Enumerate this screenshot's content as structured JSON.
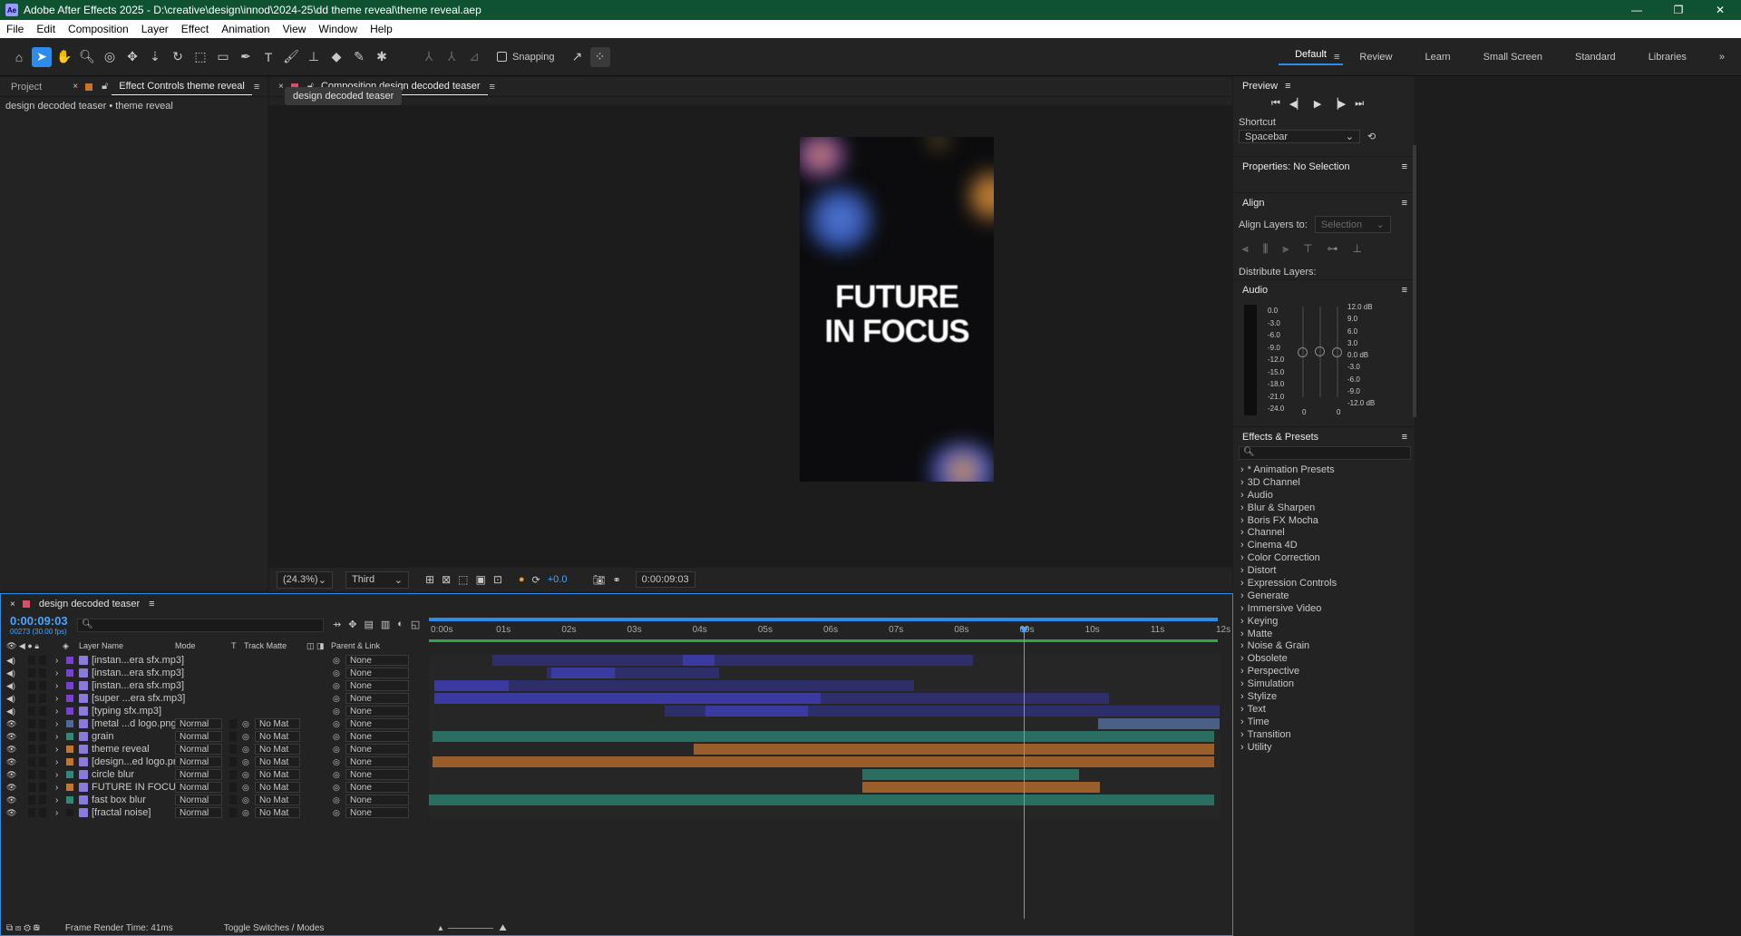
{
  "app": {
    "title": "Adobe After Effects 2025 - D:\\creative\\design\\innod\\2024-25\\dd theme reveal\\theme reveal.aep",
    "logo": "Ae"
  },
  "menu": [
    "File",
    "Edit",
    "Composition",
    "Layer",
    "Effect",
    "Animation",
    "View",
    "Window",
    "Help"
  ],
  "toolbar": {
    "snapping_label": "Snapping",
    "workspaces": [
      "Default",
      "Review",
      "Learn",
      "Small Screen",
      "Standard",
      "Libraries"
    ]
  },
  "left_panel": {
    "tabs": [
      "Project",
      "Effect Controls theme reveal"
    ],
    "path": "design decoded teaser • theme reveal"
  },
  "viewer": {
    "tab": "Composition design decoded teaser",
    "breadcrumb": "design decoded teaser",
    "comp_text_line1": "FUTURE",
    "comp_text_line2": "IN FOCUS",
    "zoom": "(24.3%)",
    "resolution": "Third",
    "exposure": "+0.0",
    "timecode": "0:00:09:03"
  },
  "right_panel": {
    "preview": "Preview",
    "shortcut_label": "Shortcut",
    "shortcut_value": "Spacebar",
    "properties": "Properties: No Selection",
    "align": "Align",
    "align_layers_to": "Align Layers to:",
    "align_selection": "Selection",
    "distribute": "Distribute Layers:",
    "audio": "Audio",
    "audio_left": [
      "0.0",
      "-3.0",
      "-6.0",
      "-9.0",
      "-12.0",
      "-15.0",
      "-18.0",
      "-21.0",
      "-24.0"
    ],
    "audio_right": [
      "12.0 dB",
      "9.0",
      "6.0",
      "3.0",
      "0.0 dB",
      "-3.0",
      "-6.0",
      "-9.0",
      "-12.0 dB"
    ],
    "audio_zero": [
      "0",
      "0"
    ],
    "effects_presets": "Effects & Presets",
    "fx_categories": [
      "* Animation Presets",
      "3D Channel",
      "Audio",
      "Blur & Sharpen",
      "Boris FX Mocha",
      "Channel",
      "Cinema 4D",
      "Color Correction",
      "Distort",
      "Expression Controls",
      "Generate",
      "Immersive Video",
      "Keying",
      "Matte",
      "Noise & Grain",
      "Obsolete",
      "Perspective",
      "Simulation",
      "Stylize",
      "Text",
      "Time",
      "Transition",
      "Utility"
    ]
  },
  "timeline": {
    "tab": "design decoded teaser",
    "timecode": "0:00:09:03",
    "frames": "00273 (30.00 fps)",
    "columns": {
      "layer_name": "Layer Name",
      "mode": "Mode",
      "t": "T",
      "track_matte": "Track Matte",
      "parent": "Parent & Link"
    },
    "ruler": [
      "0:00s",
      "01s",
      "02s",
      "03s",
      "04s",
      "05s",
      "06s",
      "07s",
      "08s",
      "09s",
      "10s",
      "11s",
      "12s"
    ],
    "layers": [
      {
        "name": "[instan...era sfx.mp3]",
        "mode": "",
        "matte": "",
        "parent": "None",
        "audio": true,
        "color": "#7a3fd6"
      },
      {
        "name": "[instan...era sfx.mp3]",
        "mode": "",
        "matte": "",
        "parent": "None",
        "audio": true,
        "color": "#7a3fd6"
      },
      {
        "name": "[instan...era sfx.mp3]",
        "mode": "",
        "matte": "",
        "parent": "None",
        "audio": true,
        "color": "#7a3fd6"
      },
      {
        "name": "[super ...era sfx.mp3]",
        "mode": "",
        "matte": "",
        "parent": "None",
        "audio": true,
        "color": "#7a3fd6"
      },
      {
        "name": "[typing sfx.mp3]",
        "mode": "",
        "matte": "",
        "parent": "None",
        "audio": true,
        "color": "#7a3fd6"
      },
      {
        "name": "[metal ...d logo.png]",
        "mode": "Normal",
        "matte": "No Mat",
        "parent": "None",
        "audio": false,
        "color": "#4d6b9a"
      },
      {
        "name": "grain",
        "mode": "Normal",
        "matte": "No Mat",
        "parent": "None",
        "audio": false,
        "color": "#2d8a78"
      },
      {
        "name": "theme reveal",
        "mode": "Normal",
        "matte": "No Mat",
        "parent": "None",
        "audio": false,
        "color": "#c8742a"
      },
      {
        "name": "[design...ed logo.png]",
        "mode": "Normal",
        "matte": "No Mat",
        "parent": "None",
        "audio": false,
        "color": "#c8742a"
      },
      {
        "name": "circle blur",
        "mode": "Normal",
        "matte": "No Mat",
        "parent": "None",
        "audio": false,
        "color": "#2d8a78"
      },
      {
        "name": "FUTURE IN FOCUS",
        "mode": "Normal",
        "matte": "No Mat",
        "parent": "None",
        "audio": false,
        "color": "#c8742a"
      },
      {
        "name": "fast box blur",
        "mode": "Normal",
        "matte": "No Mat",
        "parent": "None",
        "audio": false,
        "color": "#2d8a78"
      },
      {
        "name": "[fractal noise]",
        "mode": "Normal",
        "matte": "No Mat",
        "parent": "None",
        "audio": false,
        "color": "#1a1a1a"
      }
    ],
    "footer_render": "Frame Render Time: 41ms",
    "footer_toggle": "Toggle Switches / Modes"
  }
}
